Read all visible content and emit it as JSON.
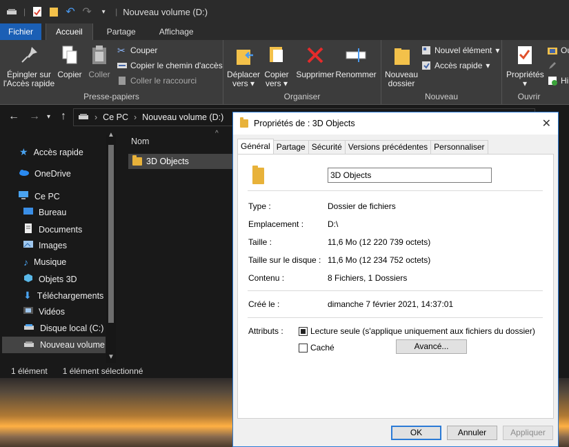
{
  "explorer": {
    "title": "Nouveau volume (D:)",
    "tabs": [
      "Fichier",
      "Accueil",
      "Partage",
      "Affichage"
    ],
    "ribbon": {
      "clipboard": {
        "label": "Presse-papiers",
        "pin": "Épingler sur l'Accès rapide",
        "copy": "Copier",
        "paste": "Coller",
        "cut": "Couper",
        "copy_path": "Copier le chemin d'accès",
        "paste_shortcut": "Coller le raccourci"
      },
      "organize": {
        "label": "Organiser",
        "move_to": "Déplacer vers",
        "copy_to": "Copier vers",
        "delete": "Supprimer",
        "rename": "Renommer"
      },
      "new": {
        "label": "Nouveau",
        "new_folder": "Nouveau dossier",
        "new_item": "Nouvel élément",
        "easy_access": "Accès rapide"
      },
      "open": {
        "label": "Ouvrir",
        "properties": "Propriétés",
        "open_short": "Ou",
        "history_short": "Hi"
      }
    },
    "breadcrumb": [
      "Ce PC",
      "Nouveau volume (D:)"
    ],
    "nav": [
      {
        "label": "Accès rapide",
        "icon": "star-icon"
      },
      {
        "label": "OneDrive",
        "icon": "cloud-icon"
      },
      {
        "label": "Ce PC",
        "icon": "computer-icon"
      },
      {
        "label": "Bureau",
        "icon": "desktop-icon"
      },
      {
        "label": "Documents",
        "icon": "document-icon"
      },
      {
        "label": "Images",
        "icon": "pictures-icon"
      },
      {
        "label": "Musique",
        "icon": "music-icon"
      },
      {
        "label": "Objets 3D",
        "icon": "cube-icon"
      },
      {
        "label": "Téléchargements",
        "icon": "download-icon"
      },
      {
        "label": "Vidéos",
        "icon": "video-icon"
      },
      {
        "label": "Disque local (C:)",
        "icon": "drive-icon"
      },
      {
        "label": "Nouveau volume (",
        "icon": "drive-icon"
      }
    ],
    "column_name": "Nom",
    "files": [
      {
        "name": "3D Objects"
      }
    ],
    "status": {
      "count": "1 élément",
      "selected": "1 élément sélectionné"
    }
  },
  "dialog": {
    "title": "Propriétés de : 3D Objects",
    "tabs": [
      "Général",
      "Partage",
      "Sécurité",
      "Versions précédentes",
      "Personnaliser"
    ],
    "name_value": "3D Objects",
    "props": {
      "type_label": "Type :",
      "type_value": "Dossier de fichiers",
      "location_label": "Emplacement :",
      "location_value": "D:\\",
      "size_label": "Taille :",
      "size_value": "11,6 Mo (12 220 739 octets)",
      "disk_size_label": "Taille sur le disque :",
      "disk_size_value": "11,6 Mo (12 234 752 octets)",
      "contents_label": "Contenu :",
      "contents_value": "8 Fichiers, 1 Dossiers",
      "created_label": "Créé le :",
      "created_value": "dimanche 7 février 2021, 14:37:01",
      "attributes_label": "Attributs :"
    },
    "readonly_label": "Lecture seule (s'applique uniquement aux fichiers du dossier)",
    "hidden_label": "Caché",
    "advanced_button": "Avancé...",
    "ok_button": "OK",
    "cancel_button": "Annuler",
    "apply_button": "Appliquer"
  }
}
